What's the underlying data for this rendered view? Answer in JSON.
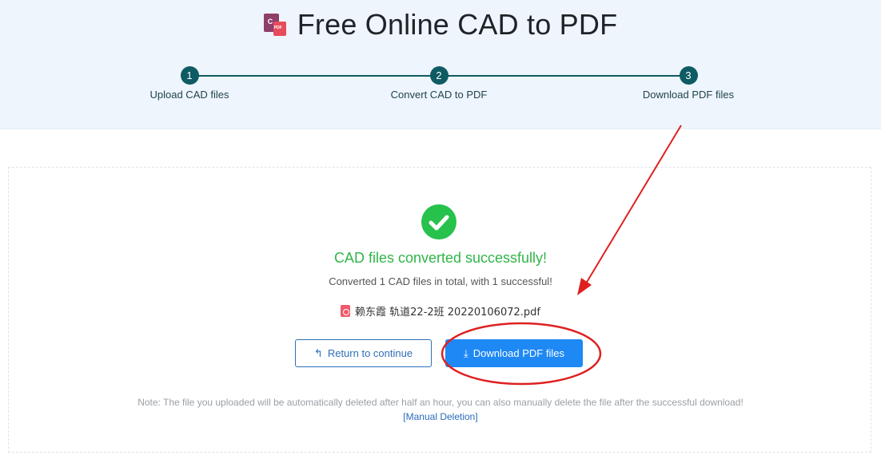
{
  "header": {
    "logo_letter": "C",
    "logo_badge": "PDF",
    "title": "Free Online CAD to PDF"
  },
  "steps": [
    {
      "number": "1",
      "label": "Upload CAD files"
    },
    {
      "number": "2",
      "label": "Convert CAD to PDF"
    },
    {
      "number": "3",
      "label": "Download PDF files"
    }
  ],
  "result": {
    "title": "CAD files converted successfully!",
    "summary": "Converted 1 CAD files in total, with 1 successful!",
    "file_name": "赖东霞 轨道22-2班 20220106072.pdf"
  },
  "buttons": {
    "return_label": "Return to continue",
    "return_icon": "↰",
    "download_label": "Download PDF files",
    "download_icon": "⤓"
  },
  "note": {
    "text": "Note: The file you uploaded will be automatically deleted after half an hour, you can also manually delete the file after the successful download!",
    "manual_link": "[Manual Deletion]"
  },
  "colors": {
    "step_accent": "#0e5b63",
    "success": "#2fb548",
    "primary": "#1e88f5",
    "annotation_red": "#e02020"
  },
  "icons": {
    "check": "check-circle-icon",
    "pdf": "pdf-file-icon",
    "return": "return-arrow-icon",
    "download": "download-icon"
  }
}
